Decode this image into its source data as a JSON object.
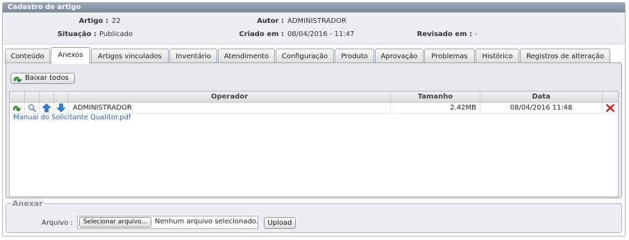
{
  "panel": {
    "title": "Cadastro de artigo"
  },
  "info": {
    "artigo_label": "Artigo :",
    "artigo_value": "22",
    "autor_label": "Autor :",
    "autor_value": "ADMINISTRADOR",
    "situacao_label": "Situação :",
    "situacao_value": "Publicado",
    "criado_label": "Criado em :",
    "criado_value": "08/04/2016 - 11:47",
    "revisado_label": "Revisado em :",
    "revisado_value": "-"
  },
  "tabs": [
    "Conteúdo",
    "Anexos",
    "Artigos vinculados",
    "Inventário",
    "Atendimento",
    "Configuração",
    "Produto",
    "Aprovação",
    "Problemas",
    "Histórico",
    "Registros de alteração"
  ],
  "active_tab": "Anexos",
  "toolbar": {
    "download_all_label": "Baixar todos"
  },
  "grid": {
    "headers": {
      "operator": "Operador",
      "size": "Tamanho",
      "date": "Data"
    },
    "rows": [
      {
        "operator": "ADMINISTRADOR",
        "size": "2.42MB",
        "date": "08/04/2016 11:48",
        "filename": "Manual do Solicitante Qualitor.pdf"
      }
    ]
  },
  "attach": {
    "legend": "Anexar",
    "file_label": "Arquivo :",
    "choose_button": "Selecionar arquivo...",
    "no_file_text": "Nenhum arquivo selecionado.",
    "upload_button": "Upload"
  },
  "colors": {
    "title_bar": "#8794a3",
    "link": "#2a5d9f",
    "download_icon": "#2e9a2a",
    "arrow_icon": "#2b7fd6",
    "delete_icon": "#d42020"
  }
}
